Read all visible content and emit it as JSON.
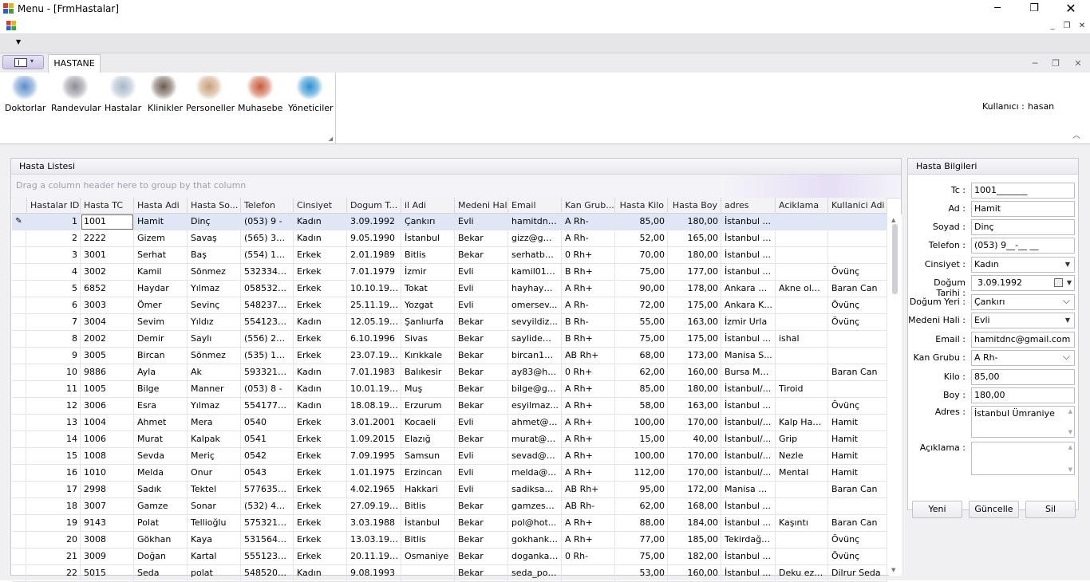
{
  "window": {
    "title": "Menu - [FrmHastalar]"
  },
  "tab": {
    "label": "HASTANE"
  },
  "ribbon": {
    "buttons": [
      {
        "label": "Doktorlar",
        "icon": "doctors-icon",
        "color": "#5b8fc9"
      },
      {
        "label": "Randevular",
        "icon": "appointments-icon",
        "color": "#8c8c96"
      },
      {
        "label": "Hastalar",
        "icon": "patients-icon",
        "color": "#a7b7c9"
      },
      {
        "label": "Klinikler",
        "icon": "clinics-icon",
        "color": "#6b5b50"
      },
      {
        "label": "Personeller",
        "icon": "staff-icon",
        "color": "#c9a07a"
      },
      {
        "label": "Muhasebe",
        "icon": "accounting-icon",
        "color": "#c85a3a"
      },
      {
        "label": "Yöneticiler",
        "icon": "managers-icon",
        "color": "#2a8fd0"
      }
    ],
    "user_label": "Kullanıcı :",
    "user_value": "hasan"
  },
  "list_panel": {
    "title": "Hasta Listesi",
    "group_hint": "Drag a column header here to group by that column"
  },
  "columns": [
    "Hastalar ID",
    "Hasta TC",
    "Hasta Adi",
    "Hasta So...",
    "Telefon",
    "Cinsiyet",
    "Dogum T...",
    "il Adi",
    "Medeni Hali",
    "Email",
    "Kan Grub...",
    "Hasta Kilo",
    "Hasta Boy",
    "adres",
    "Aciklama",
    "Kullanici Adi"
  ],
  "rows": [
    [
      "1",
      "1001",
      "Hamit",
      "Dinç",
      "(053) 9  -",
      "Kadın",
      "3.09.1992",
      "Çankırı",
      "Evli",
      "hamitdnc...",
      "A Rh-",
      "85,00",
      "180,00",
      "İstanbul ...",
      "",
      ""
    ],
    [
      "2",
      "2222",
      "Gizem",
      "Savaş",
      "(565) 321...",
      "Kadın",
      "9.05.1990",
      "İstanbul",
      "Bekar",
      "gizz@gm...",
      "A Rh-",
      "52,00",
      "165,00",
      "İstanbul Şişli",
      "",
      ""
    ],
    [
      "3",
      "3001",
      "Serhat",
      "Baş",
      "(554) 123...",
      "Erkek",
      "2.01.1989",
      "Bitlis",
      "Bekar",
      "serhatba...",
      "0 Rh+",
      "70,00",
      "180,00",
      "İstanbul ...",
      "",
      ""
    ],
    [
      "4",
      "3002",
      "Kamil",
      "Sönmez",
      "532334899",
      "Erkek",
      "7.01.1979",
      "İzmir",
      "Evli",
      "kamil01@...",
      "B Rh+",
      "75,00",
      "177,00",
      "İstanbul ...",
      "",
      "Övünç"
    ],
    [
      "5",
      "6852",
      "Haydar",
      "Yılmaz",
      "0585321...",
      "Erkek",
      "10.10.1970",
      "Tokat",
      "Evli",
      "hayhay@...",
      "A Rh+",
      "90,00",
      "178,00",
      "Ankara Kı...",
      "Akne oluş...",
      "Baran Can"
    ],
    [
      "6",
      "3003",
      "Ömer",
      "Sevinç",
      "548237899",
      "Erkek",
      "25.11.1983",
      "Yozgat",
      "Evli",
      "omersev...",
      "A Rh-",
      "72,00",
      "175,00",
      "Ankara K...",
      "",
      "Övünç"
    ],
    [
      "7",
      "3004",
      "Sevim",
      "Yıldız",
      "5541234...",
      "Kadın",
      "12.05.1985",
      "Şanlıurfa",
      "Bekar",
      "sevyildiz...",
      "B Rh-",
      "55,00",
      "163,00",
      "İzmir Urla",
      "",
      "Övünç"
    ],
    [
      "8",
      "2002",
      "Demir",
      "Saylı",
      "(556) 231...",
      "Erkek",
      "6.10.1996",
      "Sivas",
      "Bekar",
      "saylidemir...",
      "B Rh+",
      "75,00",
      "175,00",
      "İstanbul ...",
      "ishal",
      ""
    ],
    [
      "9",
      "3005",
      "Bircan",
      "Sönmez",
      "(535) 123...",
      "Erkek",
      "23.07.1992",
      "Kırıkkale",
      "Bekar",
      "bircan123...",
      "AB Rh+",
      "68,00",
      "173,00",
      "Manisa S...",
      "",
      ""
    ],
    [
      "10",
      "9886",
      "Ayla",
      "Ak",
      "5933211...",
      "Kadın",
      "7.01.1983",
      "Balıkesir",
      "Bekar",
      "ay83@ho...",
      "0 Rh+",
      "62,00",
      "160,00",
      "Bursa Me...",
      "",
      "Baran Can"
    ],
    [
      "11",
      "1005",
      "Bilge",
      "Manner",
      "(053) 8  -",
      "Kadın",
      "10.01.1995",
      "Muş",
      "Bekar",
      "bilge@gm...",
      "A Rh+",
      "85,00",
      "180,00",
      "İstanbul/...",
      "Tiroid",
      ""
    ],
    [
      "12",
      "3006",
      "Esra",
      "Yılmaz",
      "5541774...",
      "Kadın",
      "18.08.1988",
      "Erzurum",
      "Bekar",
      "esyilmaz...",
      "A Rh+",
      "58,00",
      "163,00",
      "İstanbul ...",
      "",
      "Övünç"
    ],
    [
      "13",
      "1004",
      "Ahmet",
      "Mera",
      "0540",
      "Erkek",
      "3.01.2001",
      "Kocaeli",
      "Evli",
      "ahmet@g...",
      "A Rh+",
      "100,00",
      "170,00",
      "İstanbul/...",
      "Kalp Hastası",
      "Hamit"
    ],
    [
      "14",
      "1006",
      "Murat",
      "Kalpak",
      "0541",
      "Erkek",
      "1.09.2015",
      "Elazığ",
      "Bekar",
      "murat@w...",
      "A Rh+",
      "15,00",
      "40,00",
      "İstanbul/...",
      "Grip",
      "Hamit"
    ],
    [
      "15",
      "1008",
      "Sevda",
      "Meriç",
      "0542",
      "Erkek",
      "7.09.1995",
      "Samsun",
      "Evli",
      "sevad@g...",
      "A Rh+",
      "100,00",
      "170,00",
      "İstanbul/...",
      "Nezle",
      "Hamit"
    ],
    [
      "16",
      "1010",
      "Melda",
      "Onur",
      "0543",
      "Erkek",
      "1.01.1975",
      "Erzincan",
      "Evli",
      "melda@g...",
      "A Rh+",
      "112,00",
      "170,00",
      "İstanbul/...",
      "Mental",
      "Hamit"
    ],
    [
      "17",
      "2998",
      "Sadık",
      "Tektel",
      "5776359...",
      "Erkek",
      "4.02.1965",
      "Hakkari",
      "Evli",
      "sadiksadi...",
      "AB Rh+",
      "95,00",
      "172,00",
      "Manisa Kı...",
      "",
      "Baran Can"
    ],
    [
      "18",
      "3007",
      "Gamze",
      "Sonar",
      "(532) 457...",
      "Erkek",
      "27.09.1981",
      "Bitlis",
      "Bekar",
      "gamzeso...",
      "AB Rh-",
      "62,00",
      "168,00",
      "İstanbul ...",
      "",
      ""
    ],
    [
      "19",
      "9143",
      "Polat",
      "Tellioğlu",
      "5753215...",
      "Erkek",
      "3.03.1988",
      "İstanbul",
      "Bekar",
      "pol@hot...",
      "A Rh+",
      "88,00",
      "184,00",
      "İstanbul ...",
      "Kaşıntı",
      "Baran Can"
    ],
    [
      "20",
      "3008",
      "Gökhan",
      "Kaya",
      "5315648...",
      "Erkek",
      "13.03.1984",
      "Bitlis",
      "Bekar",
      "gokhanka...",
      "A Rh+",
      "77,00",
      "185,00",
      "Tekirdağ ...",
      "",
      "Övünç"
    ],
    [
      "21",
      "3009",
      "Doğan",
      "Kartal",
      "5551231...",
      "Erkek",
      "20.11.1987",
      "Osmaniye",
      "Bekar",
      "dogankar...",
      "0 Rh-",
      "75,00",
      "182,00",
      "İstanbul ...",
      "",
      "Övünç"
    ],
    [
      "22",
      "5015",
      "Seda",
      "polat",
      "5485203...",
      "Kadın",
      "9.08.1993",
      "",
      "Bekar",
      "seda_pola...",
      "",
      "53,00",
      "160,00",
      "İstanbul ...",
      "Deku ezil...",
      "Dilrur Seda"
    ]
  ],
  "detail_panel": {
    "title": "Hasta Bilgileri",
    "fields": [
      {
        "label": "Tc :",
        "value": "1001_______"
      },
      {
        "label": "Ad :",
        "value": "Hamit"
      },
      {
        "label": "Soyad :",
        "value": "Dinç"
      },
      {
        "label": "Telefon :",
        "value": "(053) 9__-__ __"
      },
      {
        "label": "Cinsiyet :",
        "value": "Kadın"
      },
      {
        "label": "Doğum Tarihi :",
        "value": "3.09.1992"
      },
      {
        "label": "Doğum Yeri :",
        "value": "Çankırı"
      },
      {
        "label": "Medeni Hali :",
        "value": "Evli"
      },
      {
        "label": "Email :",
        "value": "hamitdnc@gmail.com"
      },
      {
        "label": "Kan Grubu :",
        "value": "A Rh-"
      },
      {
        "label": "Kilo :",
        "value": "85,00"
      },
      {
        "label": "Boy :",
        "value": "180,00"
      },
      {
        "label": "Adres :",
        "value": "İstanbul Ümraniye"
      },
      {
        "label": "Açıklama :",
        "value": ""
      }
    ],
    "buttons": {
      "new": "Yeni",
      "update": "Güncelle",
      "delete": "Sil"
    }
  }
}
